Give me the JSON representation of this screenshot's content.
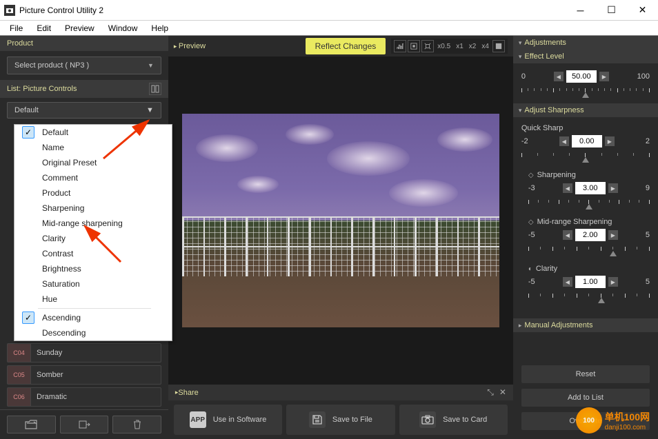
{
  "window": {
    "title": "Picture Control Utility 2"
  },
  "menubar": [
    "File",
    "Edit",
    "Preview",
    "Window",
    "Help"
  ],
  "left": {
    "product_header": "Product",
    "product_select": "Select product ( NP3 )",
    "list_header": "List: Picture Controls",
    "sort_select": "Default",
    "items": [
      {
        "num": "C04",
        "label": "Sunday"
      },
      {
        "num": "C05",
        "label": "Somber"
      },
      {
        "num": "C06",
        "label": "Dramatic"
      }
    ]
  },
  "dropdown": {
    "group1": [
      "Default",
      "Name",
      "Original Preset",
      "Comment",
      "Product",
      "Sharpening",
      "Mid-range sharpening",
      "Clarity",
      "Contrast",
      "Brightness",
      "Saturation",
      "Hue"
    ],
    "group2": [
      "Ascending",
      "Descending"
    ],
    "checked1": 0,
    "checked2": 0
  },
  "center": {
    "preview_label": "Preview",
    "reflect_btn": "Reflect Changes",
    "zoom_labels": [
      "x0.5",
      "x1",
      "x2",
      "x4"
    ],
    "share_label": "Share",
    "share_buttons": [
      {
        "icon": "APP",
        "label": "Use in Software"
      },
      {
        "icon": "save",
        "label": "Save to File"
      },
      {
        "icon": "camera",
        "label": "Save to Card"
      }
    ]
  },
  "right": {
    "sections": {
      "adjustments": "Adjustments",
      "effect_level": "Effect Level",
      "adjust_sharpness": "Adjust Sharpness",
      "manual": "Manual Adjustments"
    },
    "effect": {
      "min": "0",
      "max": "100",
      "value": "50.00"
    },
    "quick_sharp": {
      "label": "Quick Sharp",
      "min": "-2",
      "max": "2",
      "value": "0.00"
    },
    "sharpening": {
      "label": "Sharpening",
      "min": "-3",
      "max": "9",
      "value": "3.00"
    },
    "midrange": {
      "label": "Mid-range Sharpening",
      "min": "-5",
      "max": "5",
      "value": "2.00"
    },
    "clarity": {
      "label": "Clarity",
      "min": "-5",
      "max": "5",
      "value": "1.00"
    },
    "buttons": {
      "reset": "Reset",
      "add": "Add to List",
      "overwrite": "Overwrite"
    }
  },
  "watermark": {
    "site": "单机100网",
    "url": "danji100.com"
  }
}
